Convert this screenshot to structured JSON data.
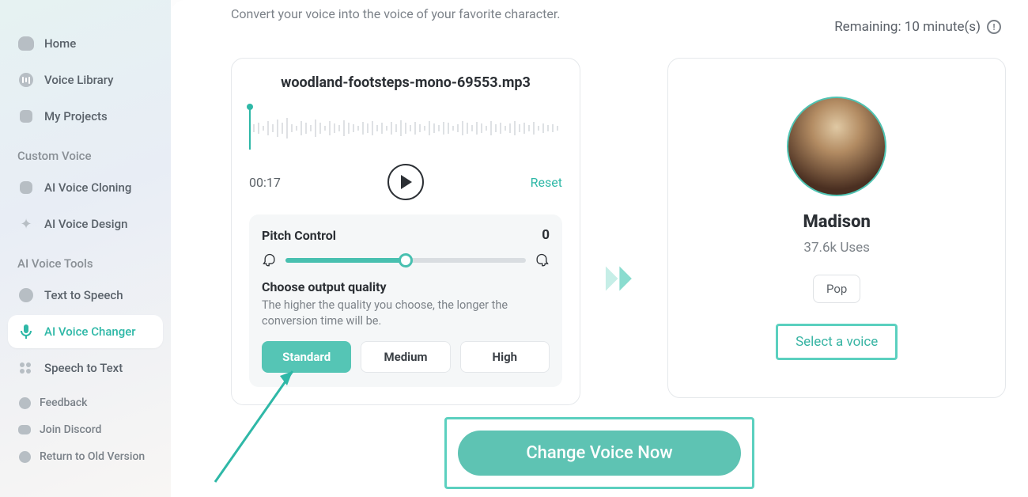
{
  "sidebar": {
    "nav": [
      {
        "label": "Home"
      },
      {
        "label": "Voice Library"
      },
      {
        "label": "My Projects"
      }
    ],
    "section_custom": "Custom Voice",
    "custom": [
      {
        "label": "AI Voice Cloning"
      },
      {
        "label": "AI Voice Design"
      }
    ],
    "section_tools": "AI Voice Tools",
    "tools": [
      {
        "label": "Text to Speech"
      },
      {
        "label": "AI Voice Changer"
      },
      {
        "label": "Speech to Text"
      }
    ],
    "links": [
      {
        "label": "Feedback"
      },
      {
        "label": "Join Discord"
      },
      {
        "label": "Return to Old Version"
      }
    ]
  },
  "header": {
    "subtitle": "Convert your voice into the voice of your favorite character.",
    "remaining_label": "Remaining: ",
    "remaining_value": "10 minute(s)"
  },
  "audio": {
    "file_name": "woodland-footsteps-mono-69553.mp3",
    "time": "00:17",
    "reset_label": "Reset",
    "pitch": {
      "title": "Pitch Control",
      "value": "0"
    },
    "quality": {
      "title": "Choose output quality",
      "desc": "The higher the quality you choose, the longer the conversion time will be.",
      "options": [
        "Standard",
        "Medium",
        "High"
      ]
    }
  },
  "voice": {
    "name": "Madison",
    "uses": "37.6k Uses",
    "tag": "Pop",
    "select_label": "Select a voice"
  },
  "cta_label": "Change Voice Now"
}
